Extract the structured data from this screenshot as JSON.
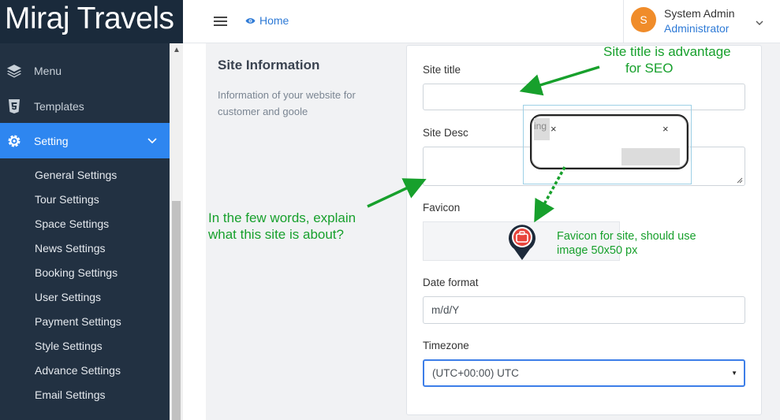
{
  "brand": {
    "name": "Miraj Travels"
  },
  "sidebar": {
    "items": [
      {
        "label": "Menu",
        "icon": "layers-icon"
      },
      {
        "label": "Templates",
        "icon": "html5-icon"
      },
      {
        "label": "Setting",
        "icon": "gear-icon",
        "active": true
      }
    ],
    "sub_items": [
      "General Settings",
      "Tour Settings",
      "Space Settings",
      "News Settings",
      "Booking Settings",
      "User Settings",
      "Payment Settings",
      "Style Settings",
      "Advance Settings",
      "Email Settings"
    ]
  },
  "topbar": {
    "home_label": "Home",
    "user": {
      "initial": "S",
      "name": "System Admin",
      "role": "Administrator"
    }
  },
  "section": {
    "title": "Site Information",
    "description": "Information of your website for customer and goole"
  },
  "form": {
    "site_title_label": "Site title",
    "site_title_value": "",
    "site_desc_label": "Site Desc",
    "site_desc_value": "",
    "favicon_label": "Favicon",
    "date_format_label": "Date format",
    "date_format_value": "m/d/Y",
    "timezone_label": "Timezone",
    "timezone_value": "(UTC+00:00) UTC"
  },
  "annotations": {
    "site_title_note_1": "Site title is advantage",
    "site_title_note_2": "for SEO",
    "desc_note_1": "In the few words, explain",
    "desc_note_2": "what this site is about?",
    "favicon_note_1": "Favicon for site, should use",
    "favicon_note_2": "image 50x50 px",
    "chip_fragment": "ing",
    "chip_close": "×"
  },
  "colors": {
    "sidebar_bg": "#223142",
    "active_item": "#2e86f0",
    "link": "#2e7ad6",
    "avatar": "#f08c2a",
    "annotation": "#17a02c",
    "favicon_red": "#e8453c"
  }
}
